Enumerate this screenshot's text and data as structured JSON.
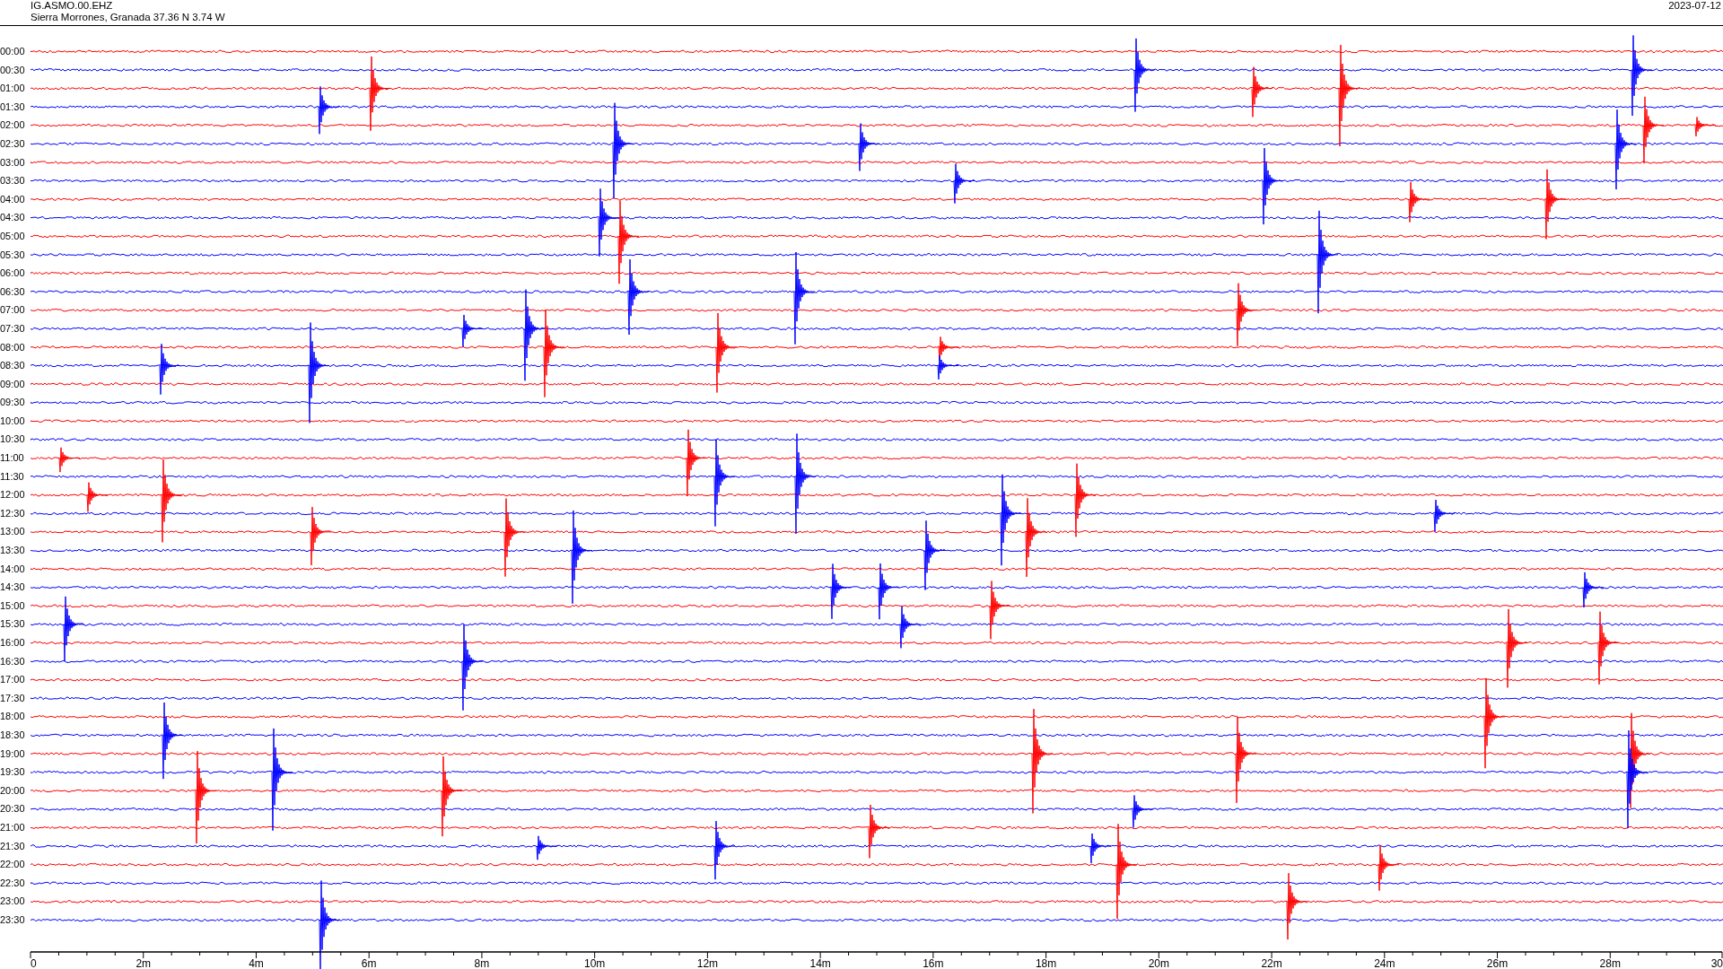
{
  "header": {
    "station": "IG.ASMO.00.EHZ",
    "location": "Sierra Morrones, Granada  37.36 N 3.74 W",
    "date": "2023-07-12"
  },
  "traces": [
    {
      "label": "00:00",
      "color": "#ff0000"
    },
    {
      "label": "00:30",
      "color": "#0000ff"
    },
    {
      "label": "01:00",
      "color": "#ff0000"
    },
    {
      "label": "01:30",
      "color": "#0000ff"
    },
    {
      "label": "02:00",
      "color": "#ff0000"
    },
    {
      "label": "02:30",
      "color": "#0000ff"
    },
    {
      "label": "03:00",
      "color": "#ff0000"
    },
    {
      "label": "03:30",
      "color": "#0000ff"
    },
    {
      "label": "04:00",
      "color": "#ff0000"
    },
    {
      "label": "04:30",
      "color": "#0000ff"
    },
    {
      "label": "05:00",
      "color": "#ff0000"
    },
    {
      "label": "05:30",
      "color": "#0000ff"
    },
    {
      "label": "06:00",
      "color": "#ff0000"
    },
    {
      "label": "06:30",
      "color": "#0000ff"
    },
    {
      "label": "07:00",
      "color": "#ff0000"
    },
    {
      "label": "07:30",
      "color": "#0000ff"
    },
    {
      "label": "08:00",
      "color": "#ff0000"
    },
    {
      "label": "08:30",
      "color": "#0000ff"
    },
    {
      "label": "09:00",
      "color": "#ff0000"
    },
    {
      "label": "09:30",
      "color": "#0000ff"
    },
    {
      "label": "10:00",
      "color": "#ff0000"
    },
    {
      "label": "10:30",
      "color": "#0000ff"
    },
    {
      "label": "11:00",
      "color": "#ff0000"
    },
    {
      "label": "11:30",
      "color": "#0000ff"
    },
    {
      "label": "12:00",
      "color": "#ff0000"
    },
    {
      "label": "12:30",
      "color": "#0000ff"
    },
    {
      "label": "13:00",
      "color": "#ff0000"
    },
    {
      "label": "13:30",
      "color": "#0000ff"
    },
    {
      "label": "14:00",
      "color": "#ff0000"
    },
    {
      "label": "14:30",
      "color": "#0000ff"
    },
    {
      "label": "15:00",
      "color": "#ff0000"
    },
    {
      "label": "15:30",
      "color": "#0000ff"
    },
    {
      "label": "16:00",
      "color": "#ff0000"
    },
    {
      "label": "16:30",
      "color": "#0000ff"
    },
    {
      "label": "17:00",
      "color": "#ff0000"
    },
    {
      "label": "17:30",
      "color": "#0000ff"
    },
    {
      "label": "18:00",
      "color": "#ff0000"
    },
    {
      "label": "18:30",
      "color": "#0000ff"
    },
    {
      "label": "19:00",
      "color": "#ff0000"
    },
    {
      "label": "19:30",
      "color": "#0000ff"
    },
    {
      "label": "20:00",
      "color": "#ff0000"
    },
    {
      "label": "20:30",
      "color": "#0000ff"
    },
    {
      "label": "21:00",
      "color": "#ff0000"
    },
    {
      "label": "21:30",
      "color": "#0000ff"
    },
    {
      "label": "22:00",
      "color": "#ff0000"
    },
    {
      "label": "22:30",
      "color": "#0000ff"
    },
    {
      "label": "23:00",
      "color": "#ff0000"
    },
    {
      "label": "23:30",
      "color": "#0000ff"
    }
  ],
  "x_axis": {
    "ticks": [
      "0",
      "2m",
      "4m",
      "6m",
      "8m",
      "10m",
      "12m",
      "14m",
      "16m",
      "18m",
      "20m",
      "22m",
      "24m",
      "26m",
      "28m",
      "30"
    ]
  }
}
